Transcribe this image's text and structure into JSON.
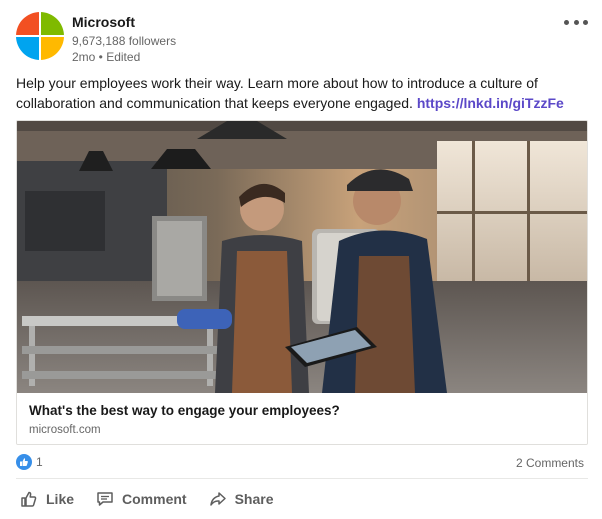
{
  "post": {
    "author_name": "Microsoft",
    "followers": "9,673,188 followers",
    "meta": "2mo • Edited",
    "text": "Help your employees work their way. Learn more about how to introduce a culture of collaboration and communication that keeps everyone engaged.",
    "link_text": "https://lnkd.in/giTzzFe"
  },
  "article": {
    "title": "What's the best way to engage your employees?",
    "source": "microsoft.com"
  },
  "social": {
    "reaction_count": "1",
    "comments": "2 Comments"
  },
  "actions": {
    "like": "Like",
    "comment": "Comment",
    "share": "Share"
  },
  "colors": {
    "logo_red": "#f25022",
    "logo_green": "#7fba00",
    "logo_blue": "#00a4ef",
    "logo_yellow": "#ffb900",
    "link": "#5b48c8",
    "like_badge": "#378fe9"
  },
  "icons": {
    "more": "more-dots-icon",
    "reaction": "thumbs-up-icon",
    "like": "thumbs-up-outline-icon",
    "comment": "comment-icon",
    "share": "share-arrow-icon"
  }
}
